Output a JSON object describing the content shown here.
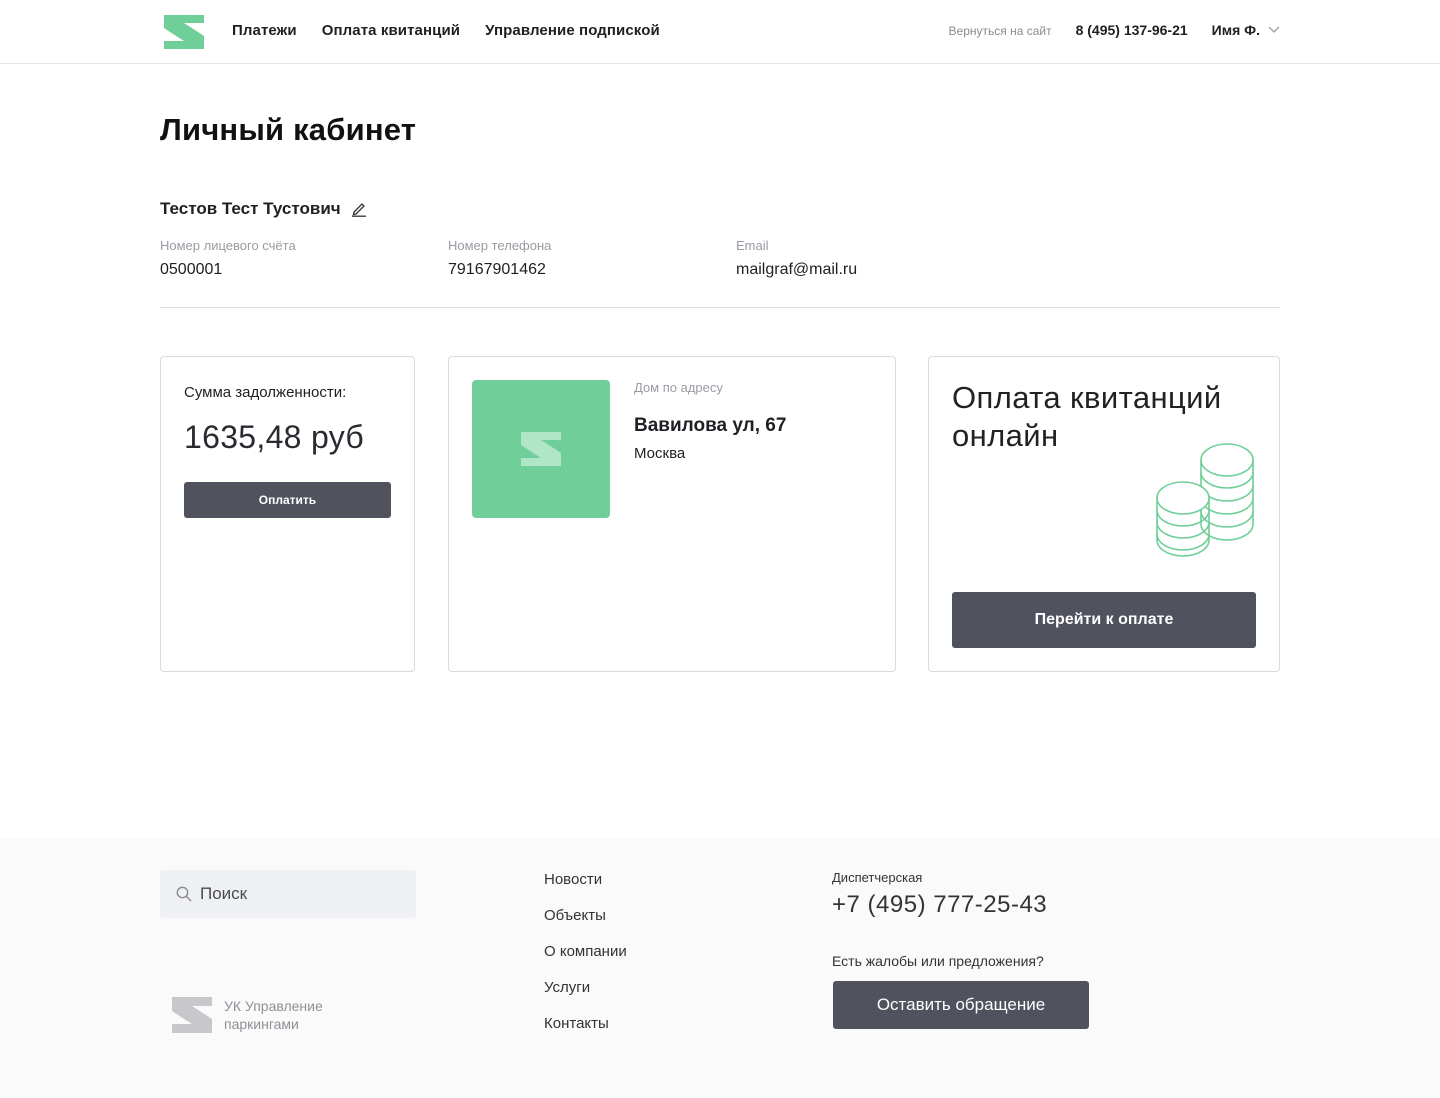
{
  "header": {
    "nav": [
      "Платежи",
      "Оплата квитанций",
      "Управление подпиской"
    ],
    "back_link": "Вернуться на сайт",
    "phone": "8 (495) 137-96-21",
    "user_name": "Имя Ф."
  },
  "page": {
    "title": "Личный кабинет"
  },
  "profile": {
    "full_name": "Тестов Тест Тустович",
    "account_label": "Номер лицевого счёта",
    "account_value": "0500001",
    "phone_label": "Номер телефона",
    "phone_value": "79167901462",
    "email_label": "Email",
    "email_value": "mailgraf@mail.ru"
  },
  "debt_card": {
    "label": "Сумма задолженности:",
    "amount": "1635,48 руб",
    "button": "Оплатить"
  },
  "house_card": {
    "caption": "Дом по адресу",
    "street": "Вавилова ул, 67",
    "city": "Москва"
  },
  "pay_card": {
    "title": "Оплата квитанций онлайн",
    "button": "Перейти к оплате"
  },
  "footer": {
    "search_placeholder": "Поиск",
    "company": "УК Управление паркингами",
    "links": [
      "Новости",
      "Объекты",
      "О компании",
      "Услуги",
      "Контакты"
    ],
    "dispatch_label": "Диспетчерская",
    "dispatch_phone": "+7 (495) 777-25-43",
    "complaint_label": "Есть жалобы или предложения?",
    "appeal_button": "Оставить обращение"
  },
  "colors": {
    "brand_green": "#70cf98",
    "button_dark": "#50535d",
    "footer_bg": "#fafafb"
  },
  "icons": [
    "logo-icon",
    "chevron-down-icon",
    "pencil-icon",
    "coins-icon",
    "search-icon"
  ]
}
